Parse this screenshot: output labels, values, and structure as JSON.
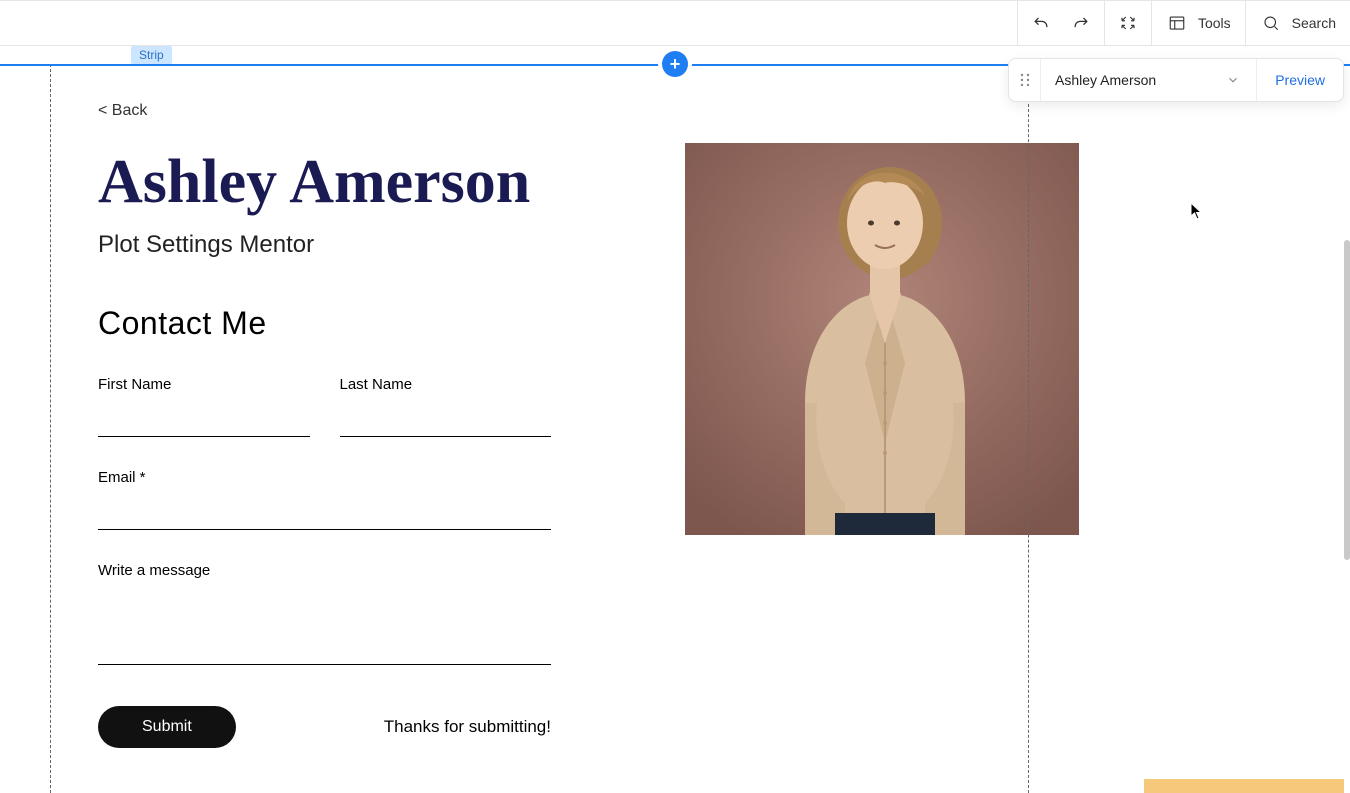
{
  "toolbar": {
    "tools_label": "Tools",
    "search_label": "Search"
  },
  "page_selector": {
    "current_page": "Ashley Amerson",
    "preview_label": "Preview"
  },
  "editor": {
    "strip_tag": "Strip"
  },
  "page": {
    "back_link": "< Back",
    "title": "Ashley Amerson",
    "subtitle": "Plot Settings Mentor",
    "contact_heading": "Contact Me",
    "form": {
      "first_name_label": "First Name",
      "last_name_label": "Last Name",
      "email_label": "Email *",
      "message_label": "Write a message",
      "submit_label": "Submit",
      "thanks_message": "Thanks for submitting!"
    }
  }
}
